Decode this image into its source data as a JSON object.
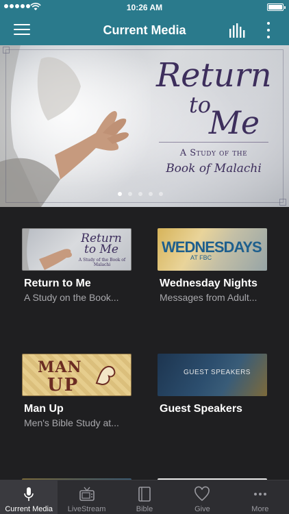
{
  "status_bar": {
    "time": "10:26 AM"
  },
  "navbar": {
    "title": "Current Media"
  },
  "hero": {
    "title_line1": "Return",
    "title_line2": "to",
    "title_line3": "Me",
    "subtitle_line1": "A Study of the",
    "subtitle_line2": "Book of Malachi",
    "pager_count": 5,
    "pager_active": 1
  },
  "media": [
    {
      "title": "Return to Me",
      "subtitle": "A Study on the Book...",
      "thumb": {
        "title1": "Return",
        "title2": "to Me",
        "subtitle": "A Study of the Book of Malachi"
      }
    },
    {
      "title": "Wednesday Nights",
      "subtitle": "Messages from Adult...",
      "thumb": {
        "title1": "WEDNESDAYS",
        "title2": "AT FBC"
      }
    },
    {
      "title": "Man Up",
      "subtitle": "Men's Bible Study at...",
      "thumb": {
        "title1": "MAN",
        "title2": "UP"
      }
    },
    {
      "title": "Guest Speakers",
      "subtitle": "",
      "thumb": {
        "title1": "GUEST SPEAKERS"
      }
    }
  ],
  "tabs": [
    {
      "label": "Current Media",
      "icon": "microphone-icon",
      "active": true
    },
    {
      "label": "LiveStream",
      "icon": "tv-icon",
      "active": false
    },
    {
      "label": "Bible",
      "icon": "book-icon",
      "active": false
    },
    {
      "label": "Give",
      "icon": "heart-icon",
      "active": false
    },
    {
      "label": "More",
      "icon": "more-dots-icon",
      "active": false
    }
  ],
  "colors": {
    "nav_bar": "#2a7a8c",
    "background": "#1f1f21",
    "tab_bar": "#2d2d31",
    "hero_title": "#3d2e5c"
  }
}
